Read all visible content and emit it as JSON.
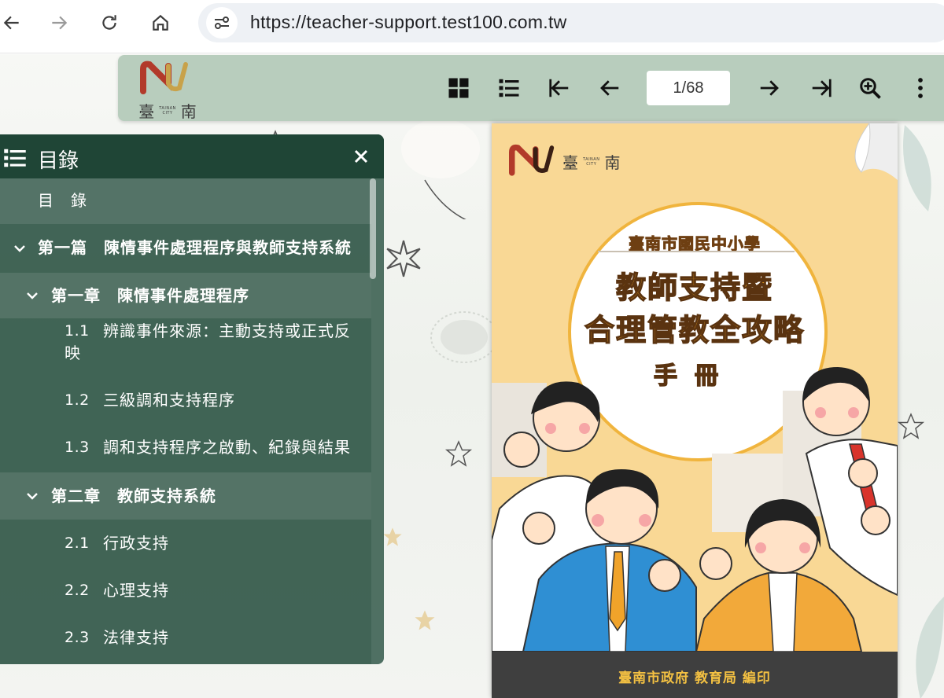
{
  "browser": {
    "url": "https://teacher-support.test100.com.tw"
  },
  "viewer": {
    "brand": {
      "char1": "臺",
      "char2": "南",
      "en_line1": "TAINAN",
      "en_line2": "CITY"
    },
    "page_indicator": "1/68",
    "colors": {
      "toolbar": "#b8cdbd",
      "panel": "#285040",
      "panel_header": "#1f4536"
    }
  },
  "toc": {
    "title": "目錄",
    "items": [
      {
        "kind": "entry",
        "label": "目　錄"
      },
      {
        "kind": "part",
        "label": "第一篇　陳情事件處理程序與教師支持系統"
      },
      {
        "kind": "chapter",
        "label": "第一章　陳情事件處理程序"
      },
      {
        "kind": "section",
        "num": "1.1",
        "label_line1": "辨識事件來源：主動支持或正式反",
        "label_line2": "映"
      },
      {
        "kind": "section",
        "num": "1.2",
        "label_line1": "三級調和支持程序"
      },
      {
        "kind": "section",
        "num": "1.3",
        "label_line1": "調和支持程序之啟動、紀錄與結果"
      },
      {
        "kind": "chapter",
        "label": "第二章　教師支持系統"
      },
      {
        "kind": "section",
        "num": "2.1",
        "label_line1": "行政支持"
      },
      {
        "kind": "section",
        "num": "2.2",
        "label_line1": "心理支持"
      },
      {
        "kind": "section",
        "num": "2.3",
        "label_line1": "法律支持"
      }
    ]
  },
  "cover": {
    "logo": {
      "char1": "臺",
      "char2": "南",
      "en_line1": "TAINAN",
      "en_line2": "CITY"
    },
    "subtitle": "臺南市國民中小學",
    "title_line1": "教師支持暨",
    "title_line2": "合理管教全攻略",
    "handbook": "手冊",
    "publisher": "臺南市政府 教育局 編印",
    "colors": {
      "background": "#f9d895",
      "title": "#f6a81c",
      "footer": "#3f3f3f",
      "footer_text": "#f4c142"
    }
  }
}
